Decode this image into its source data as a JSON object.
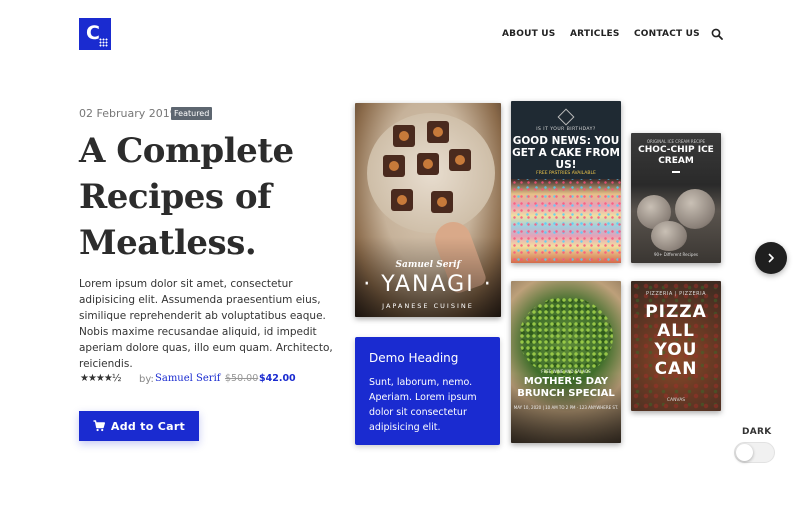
{
  "brand": {
    "logo_letter": "C",
    "accent_color": "#1a2bd0"
  },
  "nav": {
    "about": "ABOUT US",
    "articles": "ARTICLES",
    "contact": "CONTACT US",
    "search_icon": "search-icon"
  },
  "post": {
    "date": "02 February 2019",
    "badge": "Featured",
    "title_lines": [
      "A Complete",
      "Recipes of",
      "Meatless."
    ],
    "description": "Lorem ipsum dolor sit amet, consectetur adipisicing elit. Assumenda praesentium eius, similique reprehenderit ab voluptatibus eaque. Nobis maxime recusandae aliquid, id impedit aperiam dolore quas, illo eum quam. Architecto, reiciendis.",
    "rating_stars": "★★★★½",
    "rating_value": 4.5,
    "by_label": "by:",
    "author": "Samuel Serif",
    "old_price": "$50.00",
    "new_price": "$42.00",
    "cta_label": "Add to Cart"
  },
  "covers": {
    "yanagi": {
      "author": "Samuel Serif",
      "name": "· YANAGI ·",
      "subtitle": "JAPANESE CUISINE"
    },
    "news": {
      "small": "IS IT YOUR BIRTHDAY?",
      "headline": "GOOD NEWS: YOU GET A CAKE FROM US!",
      "sub": "FREE PASTRIES AVAILABLE"
    },
    "choc": {
      "small": "ORIGINAL ICE CREAM RECIPE",
      "headline": "CHOC-CHIP ICE CREAM",
      "foot": "90+ Different Recipes"
    },
    "mother": {
      "small": "FREE WINE AND SALADS",
      "headline": "MOTHER'S DAY BRUNCH SPECIAL",
      "foot": "MAY 10, 2020 | 10 AM TO 2 PM · 123 ANYWHERE ST."
    },
    "pizza": {
      "small": "PIZZERIA | PIZZERIA",
      "headline_lines": [
        "PIZZA",
        "ALL",
        "YOU",
        "CAN"
      ],
      "foot": "CANVAS"
    }
  },
  "demo_card": {
    "heading": "Demo Heading",
    "text": "Sunt, laborum, nemo. Aperiam. Lorem ipsum dolor sit consectetur adipisicing elit."
  },
  "theme_toggle": {
    "label": "DARK",
    "enabled": false
  }
}
